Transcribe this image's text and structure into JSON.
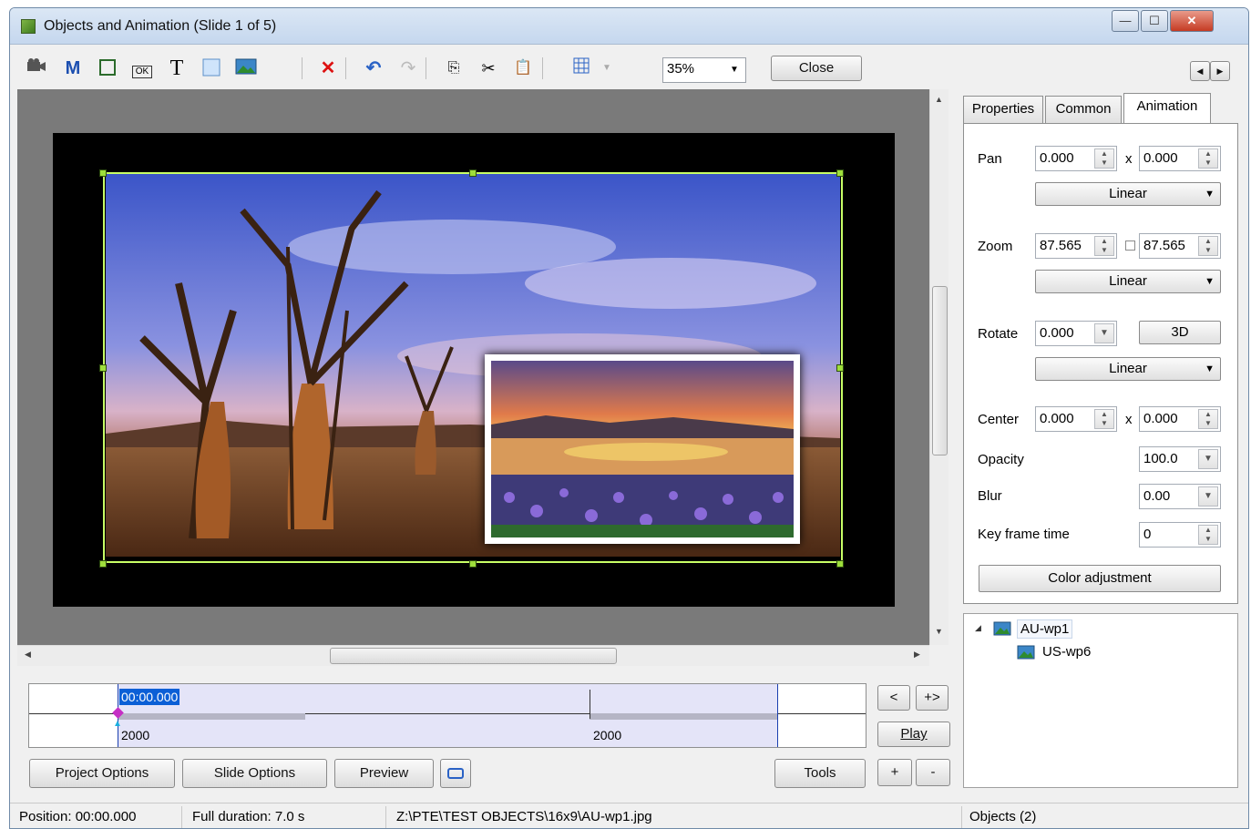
{
  "window": {
    "title": "Objects and Animation  (Slide 1 of 5)",
    "buttons": {
      "minimize": "—",
      "maximize": "☐",
      "close": "✕"
    }
  },
  "toolbar": {
    "icons": [
      "camera-icon",
      "m-icon",
      "frame-icon",
      "ok-button-icon",
      "text-icon",
      "rectangle-icon",
      "image-icon",
      "delete-icon",
      "undo-icon",
      "redo-icon",
      "copy-icon",
      "cut-icon",
      "paste-icon",
      "grid-icon"
    ],
    "m_label": "M",
    "ok_label": "OK",
    "text_label": "T",
    "zoom_value": "35%",
    "close_label": "Close"
  },
  "tabs": {
    "properties": "Properties",
    "common": "Common",
    "animation": "Animation"
  },
  "animation": {
    "pan_label": "Pan",
    "pan_x": "0.000",
    "pan_y": "0.000",
    "pan_x_sep": "x",
    "pan_mode": "Linear",
    "zoom_label": "Zoom",
    "zoom_x": "87.565",
    "zoom_y": "87.565",
    "zoom_mode": "Linear",
    "rotate_label": "Rotate",
    "rotate_value": "0.000",
    "rotate_3d": "3D",
    "rotate_mode": "Linear",
    "center_label": "Center",
    "center_x": "0.000",
    "center_y": "0.000",
    "center_x_sep": "x",
    "opacity_label": "Opacity",
    "opacity_value": "100.0",
    "blur_label": "Blur",
    "blur_value": "0.00",
    "keyframe_label": "Key frame time",
    "keyframe_value": "0",
    "color_adjustment": "Color adjustment"
  },
  "tree": {
    "root": "AU-wp1",
    "child": "US-wp6"
  },
  "timeline": {
    "current_time": "00:00.000",
    "marker1": "2000",
    "marker2": "2000",
    "prev_btn": "<",
    "next_btn": "+>",
    "play_btn": "Play",
    "add_btn": "+",
    "remove_btn": "-"
  },
  "bottom": {
    "project_options": "Project Options",
    "slide_options": "Slide Options",
    "preview": "Preview",
    "tools": "Tools"
  },
  "status": {
    "position": "Position:  00:00.000",
    "duration": "Full duration:  7.0 s",
    "path": "Z:\\PTE\\TEST OBJECTS\\16x9\\AU-wp1.jpg",
    "objects": "Objects (2)"
  },
  "colors": {
    "selection": "#c8ff66",
    "timeline_active": "#0b5fd6",
    "window_border": "#6f8aa8"
  }
}
